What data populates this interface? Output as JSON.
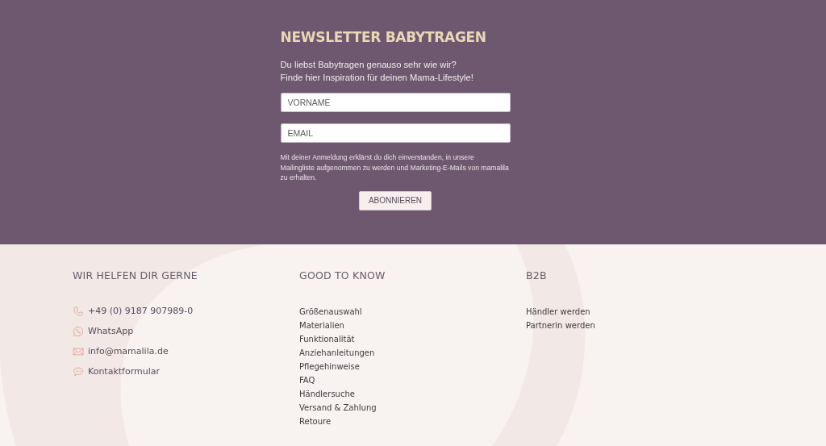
{
  "newsletter": {
    "title": "NEWSLETTER BABYTRAGEN",
    "intro": [
      "Du liebst Babytragen genauso sehr wie wir?",
      "Finde hier Inspiration für deinen Mama-Lifestyle!"
    ],
    "fields": [
      {
        "placeholder": "VORNAME"
      },
      {
        "placeholder": "EMAIL"
      }
    ],
    "consent": "Mit deiner Anmeldung erklärst du dich einverstanden, in unsere Mailingliste aufgenommen zu werden und Marketing-E-Mails von mamalila zu erhalten.",
    "button": "ABONNIEREN"
  },
  "footer": {
    "columns": [
      {
        "heading": "WIR HELFEN DIR GERNE",
        "contacts": [
          {
            "kind": "phone",
            "label": "+49 (0) 9187 907989-0"
          },
          {
            "kind": "whatsapp",
            "label": "WhatsApp"
          },
          {
            "kind": "mail",
            "label": "info@mamalila.de"
          },
          {
            "kind": "chat",
            "label": "Kontaktformular"
          }
        ]
      },
      {
        "heading": "GOOD TO KNOW",
        "links": [
          "Größenauswahl",
          "Materialien",
          "Funktionalität",
          "Anziehanleitungen",
          "Pflegehinweise",
          "FAQ",
          "Händlersuche",
          "Versand & Zahlung",
          "Retoure"
        ]
      },
      {
        "heading": "B2B",
        "links": [
          "Händler werden",
          "Partnerin werden"
        ]
      }
    ]
  }
}
